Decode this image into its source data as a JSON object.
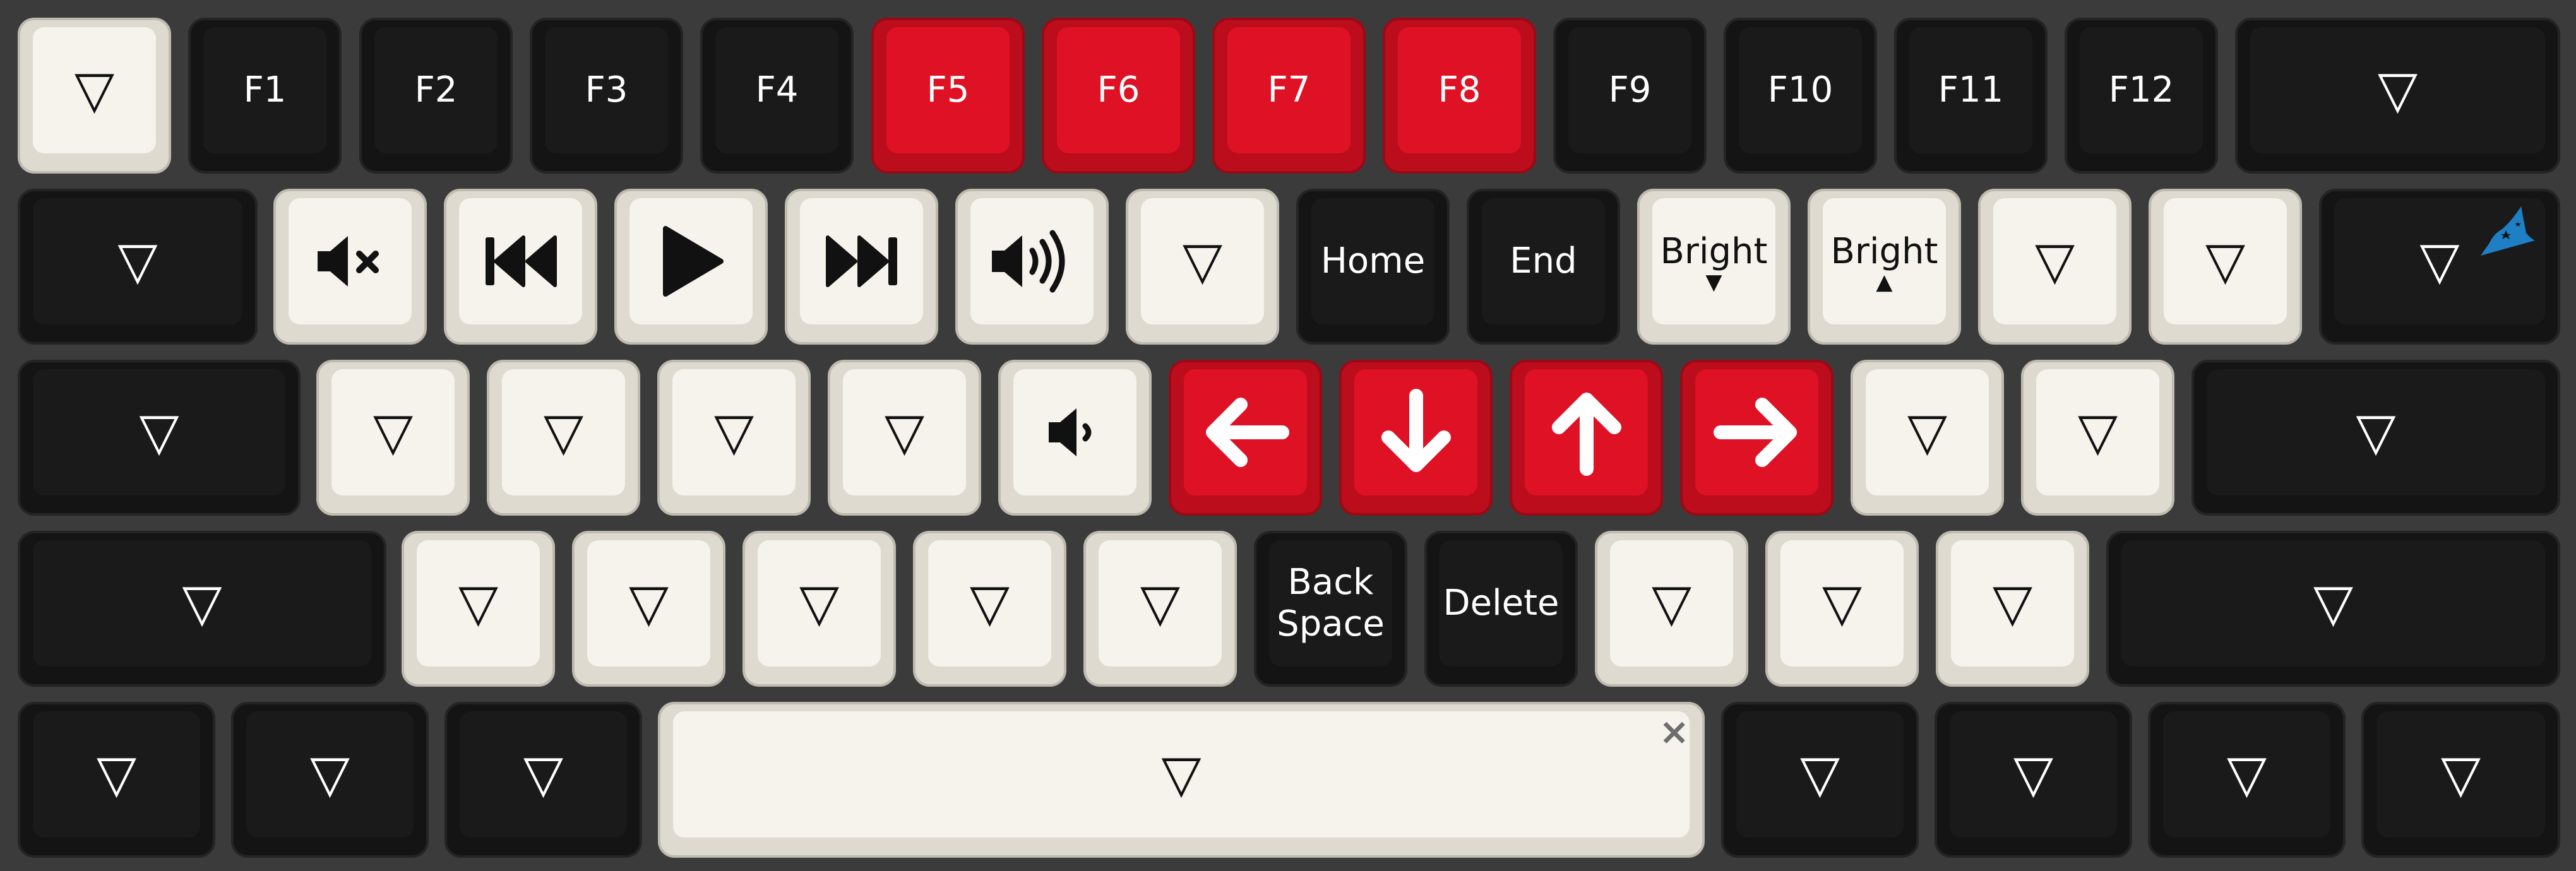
{
  "keys": {
    "r1c1": {
      "label": "▽"
    },
    "f1": {
      "label": "F1"
    },
    "f2": {
      "label": "F2"
    },
    "f3": {
      "label": "F3"
    },
    "f4": {
      "label": "F4"
    },
    "f5": {
      "label": "F5"
    },
    "f6": {
      "label": "F6"
    },
    "f7": {
      "label": "F7"
    },
    "f8": {
      "label": "F8"
    },
    "f9": {
      "label": "F9"
    },
    "f10": {
      "label": "F10"
    },
    "f11": {
      "label": "F11"
    },
    "f12": {
      "label": "F12"
    },
    "r1c14": {
      "label": "▽"
    },
    "r2c1": {
      "label": "▽"
    },
    "r2c7": {
      "label": "▽"
    },
    "home": {
      "label": "Home"
    },
    "end": {
      "label": "End"
    },
    "bright_down": {
      "label": "Bright",
      "arrow": "▼"
    },
    "bright_up": {
      "label": "Bright",
      "arrow": "▲"
    },
    "r2c12": {
      "label": "▽"
    },
    "r2c13": {
      "label": "▽"
    },
    "r2c14": {
      "label": "▽"
    },
    "r3c1": {
      "label": "▽"
    },
    "r3c2": {
      "label": "▽"
    },
    "r3c3": {
      "label": "▽"
    },
    "r3c4": {
      "label": "▽"
    },
    "r3c5": {
      "label": "▽"
    },
    "r3c11": {
      "label": "▽"
    },
    "r3c12": {
      "label": "▽"
    },
    "r3c13": {
      "label": "▽"
    },
    "r4c1": {
      "label": "▽"
    },
    "r4c2": {
      "label": "▽"
    },
    "r4c3": {
      "label": "▽"
    },
    "r4c4": {
      "label": "▽"
    },
    "r4c5": {
      "label": "▽"
    },
    "r4c6": {
      "label": "▽"
    },
    "backspace": {
      "line1": "Back",
      "line2": "Space"
    },
    "delete": {
      "label": "Delete"
    },
    "r4c9": {
      "label": "▽"
    },
    "r4c10": {
      "label": "▽"
    },
    "r4c11": {
      "label": "▽"
    },
    "r4c12": {
      "label": "▽"
    },
    "r5c1": {
      "label": "▽"
    },
    "r5c2": {
      "label": "▽"
    },
    "r5c3": {
      "label": "▽"
    },
    "space": {
      "label": "▽",
      "corner": "×"
    },
    "r5c5": {
      "label": "▽"
    },
    "r5c6": {
      "label": "▽"
    },
    "r5c7": {
      "label": "▽"
    },
    "r5c8": {
      "label": "▽"
    }
  },
  "icons": {
    "mute": "volume-mute-icon",
    "prev": "previous-track-icon",
    "play": "play-icon",
    "next": "next-track-icon",
    "vol_up": "volume-up-icon",
    "vol_down": "volume-down-icon",
    "left": "arrow-left-icon",
    "down": "arrow-down-icon",
    "up": "arrow-up-icon",
    "right": "arrow-right-icon",
    "logo": "wizard-hat-logo-icon"
  },
  "colors": {
    "case": "#3b3b3b",
    "black_key": "#1a1a1a",
    "white_key": "#f6f3ec",
    "red_key": "#df1125",
    "logo": "#1f7fc4"
  }
}
